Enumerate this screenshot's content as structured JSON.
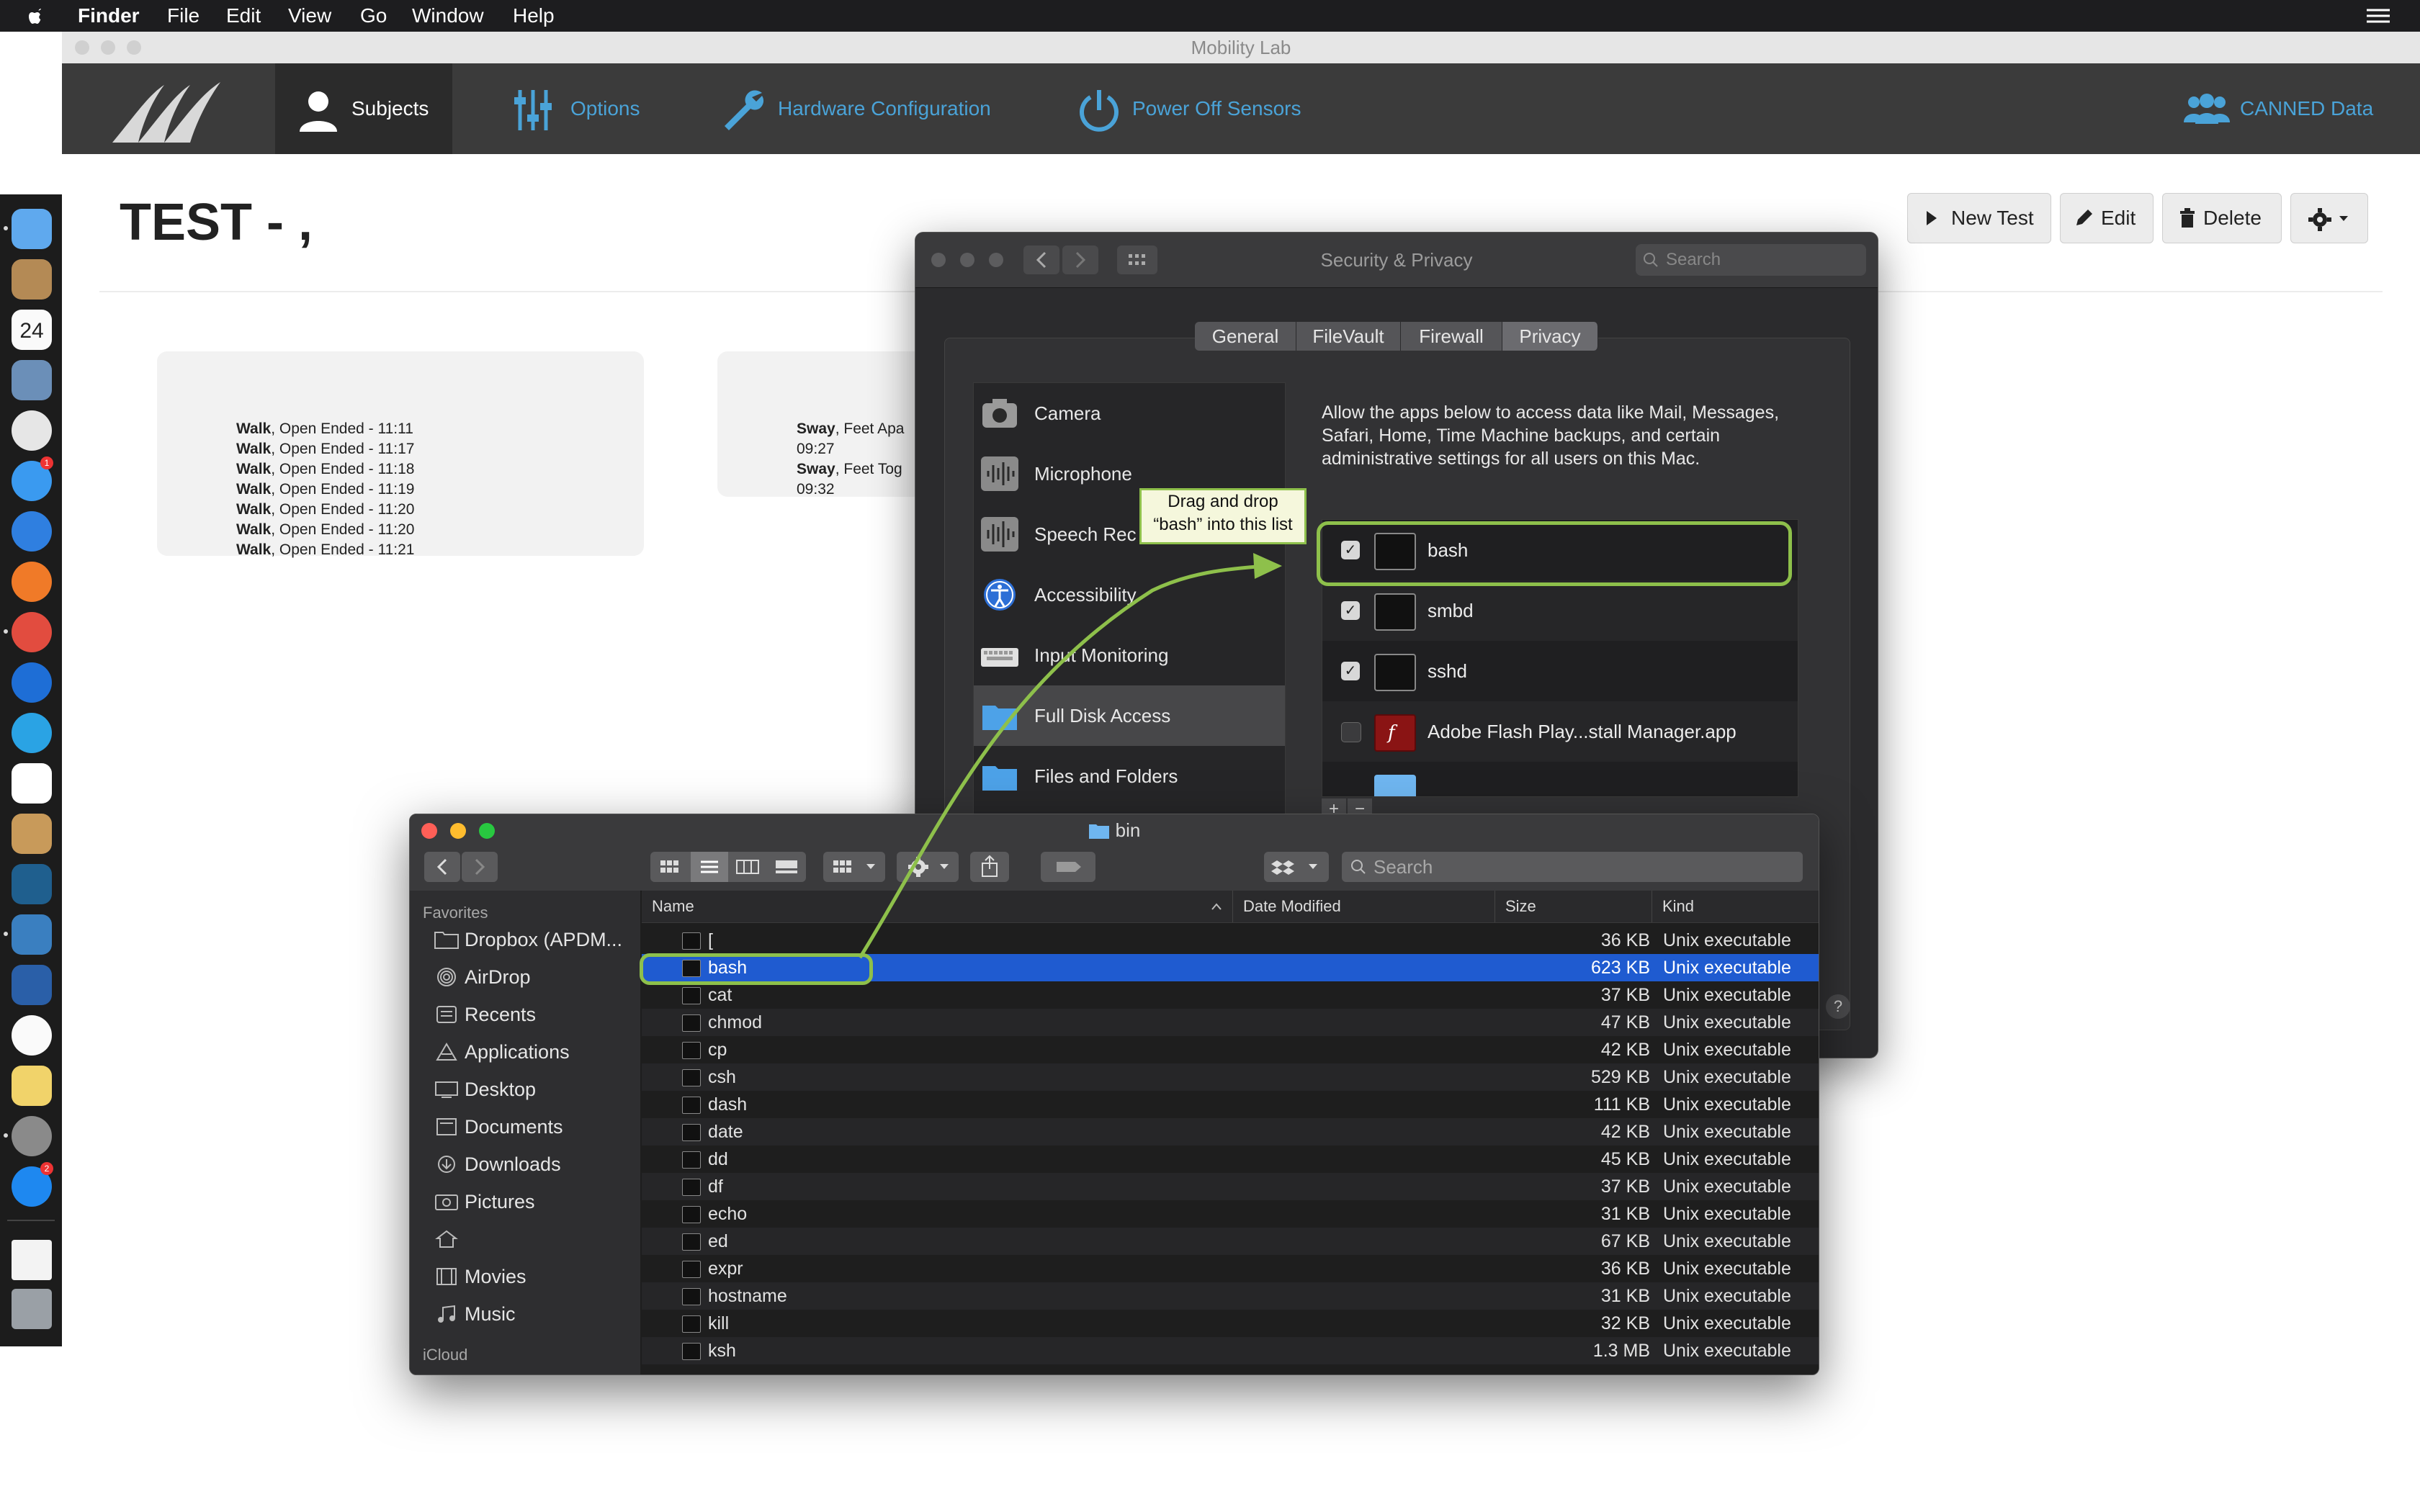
{
  "menubar": {
    "app": "Finder",
    "items": [
      "File",
      "Edit",
      "View",
      "Go",
      "Window",
      "Help"
    ]
  },
  "dock": {
    "icons": [
      "finder-icon",
      "notes-icon",
      "calendar-icon",
      "preview-icon",
      "slack-icon",
      "messages-icon",
      "safari-icon",
      "firefox-icon",
      "chrome-icon",
      "teamviewer-icon",
      "skype-icon",
      "pdf-icon",
      "paintbrush-icon",
      "waveform-icon",
      "boot-icon",
      "hair-icon",
      "music-icon",
      "stickies-icon",
      "system-preferences-icon",
      "app-store-icon",
      "document-icon",
      "trash-icon"
    ],
    "calendar_day": "24",
    "messages_badge": "1",
    "appstore_badge": "2"
  },
  "app": {
    "window_title": "Mobility Lab",
    "nav": {
      "subjects": "Subjects",
      "options": "Options",
      "hardware": "Hardware Configuration",
      "power": "Power Off Sensors",
      "canned": "CANNED Data"
    },
    "page_title": "TEST - ,",
    "buttons": {
      "new_test": "New Test",
      "edit": "Edit",
      "delete": "Delete"
    },
    "cards": [
      {
        "lines": [
          {
            "bold": "Walk",
            "rest": ", Open Ended - 11:11"
          },
          {
            "bold": "Walk",
            "rest": ", Open Ended - 11:17"
          },
          {
            "bold": "Walk",
            "rest": ", Open Ended - 11:18"
          },
          {
            "bold": "Walk",
            "rest": ", Open Ended - 11:19"
          },
          {
            "bold": "Walk",
            "rest": ", Open Ended - 11:20"
          },
          {
            "bold": "Walk",
            "rest": ", Open Ended - 11:20"
          },
          {
            "bold": "Walk",
            "rest": ", Open Ended - 11:21"
          }
        ]
      },
      {
        "lines": [
          {
            "bold": "Sway",
            "rest": ", Feet Apa"
          },
          {
            "bold": "",
            "rest": "09:27"
          },
          {
            "bold": "Sway",
            "rest": ", Feet Tog"
          },
          {
            "bold": "",
            "rest": "09:32"
          }
        ]
      }
    ]
  },
  "security": {
    "title": "Security & Privacy",
    "search_placeholder": "Search",
    "tabs": [
      "General",
      "FileVault",
      "Firewall",
      "Privacy"
    ],
    "active_tab": "Privacy",
    "categories": [
      "Camera",
      "Microphone",
      "Speech Rec",
      "Accessibility",
      "Input Monitoring",
      "Full Disk Access",
      "Files and Folders"
    ],
    "selected_category": "Full Disk Access",
    "description": "Allow the apps below to access data like Mail, Messages, Safari, Home, Time Machine backups, and certain administrative settings for all users on this Mac.",
    "apps": [
      {
        "name": "bash",
        "checked": true
      },
      {
        "name": "smbd",
        "checked": true
      },
      {
        "name": "sshd",
        "checked": true
      },
      {
        "name": "Adobe Flash Play...stall Manager.app",
        "checked": false
      }
    ],
    "add_label": "+",
    "remove_label": "−",
    "help_label": "?"
  },
  "callout": {
    "line1": "Drag and drop",
    "line2": "“bash” into this list"
  },
  "finder": {
    "title": "bin",
    "search_placeholder": "Search",
    "sidebar": {
      "favorites_header": "Favorites",
      "items": [
        {
          "label": "Dropbox (APDM...",
          "icon": "folder-icon"
        },
        {
          "label": "AirDrop",
          "icon": "airdrop-icon"
        },
        {
          "label": "Recents",
          "icon": "recents-icon"
        },
        {
          "label": "Applications",
          "icon": "applications-icon"
        },
        {
          "label": "Desktop",
          "icon": "desktop-icon"
        },
        {
          "label": "Documents",
          "icon": "documents-icon"
        },
        {
          "label": "Downloads",
          "icon": "downloads-icon"
        },
        {
          "label": "Pictures",
          "icon": "pictures-icon"
        },
        {
          "label": "",
          "icon": "home-icon"
        },
        {
          "label": "Movies",
          "icon": "movies-icon"
        },
        {
          "label": "Music",
          "icon": "music-icon"
        }
      ],
      "icloud_header": "iCloud"
    },
    "columns": {
      "name": "Name",
      "date": "Date Modified",
      "size": "Size",
      "kind": "Kind"
    },
    "files": [
      {
        "name": "[",
        "size": "36 KB",
        "kind": "Unix executable"
      },
      {
        "name": "bash",
        "size": "623 KB",
        "kind": "Unix executable"
      },
      {
        "name": "cat",
        "size": "37 KB",
        "kind": "Unix executable"
      },
      {
        "name": "chmod",
        "size": "47 KB",
        "kind": "Unix executable"
      },
      {
        "name": "cp",
        "size": "42 KB",
        "kind": "Unix executable"
      },
      {
        "name": "csh",
        "size": "529 KB",
        "kind": "Unix executable"
      },
      {
        "name": "dash",
        "size": "111 KB",
        "kind": "Unix executable"
      },
      {
        "name": "date",
        "size": "42 KB",
        "kind": "Unix executable"
      },
      {
        "name": "dd",
        "size": "45 KB",
        "kind": "Unix executable"
      },
      {
        "name": "df",
        "size": "37 KB",
        "kind": "Unix executable"
      },
      {
        "name": "echo",
        "size": "31 KB",
        "kind": "Unix executable"
      },
      {
        "name": "ed",
        "size": "67 KB",
        "kind": "Unix executable"
      },
      {
        "name": "expr",
        "size": "36 KB",
        "kind": "Unix executable"
      },
      {
        "name": "hostname",
        "size": "31 KB",
        "kind": "Unix executable"
      },
      {
        "name": "kill",
        "size": "32 KB",
        "kind": "Unix executable"
      },
      {
        "name": "ksh",
        "size": "1.3 MB",
        "kind": "Unix executable"
      }
    ],
    "selected_file": "bash"
  },
  "colors": {
    "nav_bg": "#3b3b3b",
    "nav_accent": "#4aa3d8",
    "selection_blue": "#1f5bd0",
    "annotation_green": "#8ec04b"
  }
}
